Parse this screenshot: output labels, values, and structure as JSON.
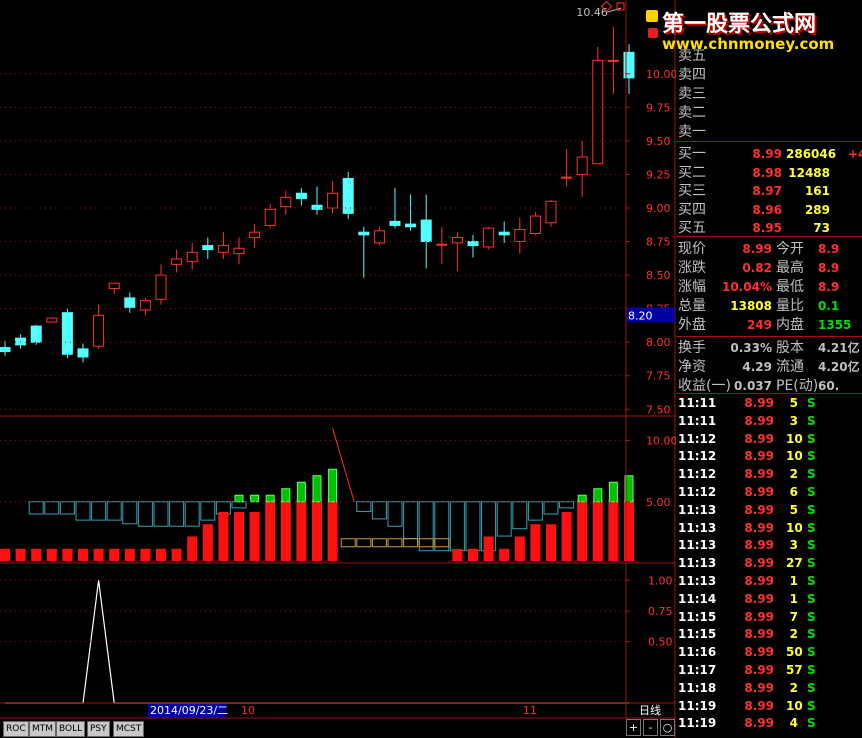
{
  "chart_data": [
    {
      "type": "candlestick",
      "y_ticks": [
        "10.00",
        "9.75",
        "9.50",
        "9.25",
        "9.00",
        "8.75",
        "8.50",
        "8.25",
        "8.00",
        "7.75",
        "7.50"
      ],
      "ylim": [
        7.45,
        10.55
      ],
      "annotation_high": "10.46",
      "annotation_level": "8.20",
      "candles": [
        [
          7.96,
          7.93,
          8.01,
          7.9
        ],
        [
          8.03,
          7.98,
          8.06,
          7.95
        ],
        [
          8.12,
          8.0,
          8.13,
          7.98
        ],
        [
          8.15,
          8.18,
          8.15,
          8.18
        ],
        [
          8.22,
          7.91,
          8.25,
          7.88
        ],
        [
          7.95,
          7.89,
          7.99,
          7.85
        ],
        [
          7.97,
          8.2,
          8.28,
          7.95
        ],
        [
          8.4,
          8.44,
          8.44,
          8.36
        ],
        [
          8.33,
          8.26,
          8.37,
          8.22
        ],
        [
          8.24,
          8.31,
          8.33,
          8.2
        ],
        [
          8.32,
          8.5,
          8.58,
          8.28
        ],
        [
          8.58,
          8.62,
          8.69,
          8.52
        ],
        [
          8.6,
          8.67,
          8.74,
          8.54
        ],
        [
          8.72,
          8.69,
          8.78,
          8.62
        ],
        [
          8.67,
          8.72,
          8.82,
          8.62
        ],
        [
          8.66,
          8.7,
          8.78,
          8.58
        ],
        [
          8.78,
          8.82,
          8.88,
          8.7
        ],
        [
          8.87,
          8.99,
          9.03,
          8.85
        ],
        [
          9.01,
          9.08,
          9.13,
          8.95
        ],
        [
          9.11,
          9.07,
          9.15,
          9.02
        ],
        [
          9.02,
          8.99,
          9.16,
          8.95
        ],
        [
          9.0,
          9.11,
          9.2,
          8.96
        ],
        [
          9.22,
          8.96,
          9.27,
          8.92
        ],
        [
          8.82,
          8.8,
          8.86,
          8.48
        ],
        [
          8.74,
          8.83,
          8.86,
          8.72
        ],
        [
          8.9,
          8.87,
          9.15,
          8.85
        ],
        [
          8.88,
          8.86,
          9.1,
          8.83
        ],
        [
          8.91,
          8.75,
          9.1,
          8.55
        ],
        [
          8.73,
          8.73,
          8.86,
          8.58
        ],
        [
          8.74,
          8.78,
          8.82,
          8.53
        ],
        [
          8.75,
          8.72,
          8.8,
          8.63
        ],
        [
          8.71,
          8.85,
          8.86,
          8.69
        ],
        [
          8.82,
          8.8,
          8.9,
          8.74
        ],
        [
          8.75,
          8.84,
          8.93,
          8.66
        ],
        [
          8.81,
          8.94,
          8.97,
          8.8
        ],
        [
          8.89,
          9.05,
          9.06,
          8.86
        ],
        [
          9.23,
          9.23,
          9.44,
          9.16
        ],
        [
          9.25,
          9.38,
          9.5,
          9.08
        ],
        [
          9.33,
          10.1,
          10.2,
          9.33
        ],
        [
          10.1,
          10.1,
          10.35,
          9.85
        ],
        [
          10.16,
          9.97,
          10.22,
          9.85
        ]
      ]
    },
    {
      "type": "bar",
      "y_ticks": [
        "10.00",
        "5.00"
      ],
      "ylim": [
        0,
        12
      ],
      "base": 5,
      "red": [
        1,
        1,
        1,
        1,
        1,
        1,
        1,
        1,
        1,
        1,
        1,
        1,
        2,
        3,
        4,
        4,
        4,
        5,
        5,
        5,
        5,
        5,
        0,
        0,
        0,
        0,
        0,
        0,
        0,
        -1,
        1,
        2,
        1,
        2,
        3,
        3,
        4,
        5,
        5,
        5,
        5
      ],
      "green": [
        0,
        0,
        0,
        0,
        0,
        0,
        0,
        0,
        0,
        0,
        0,
        0,
        0,
        0,
        0,
        1,
        1,
        1,
        2,
        3,
        4,
        5,
        0,
        0,
        0,
        0,
        0,
        0,
        0,
        0,
        0,
        0,
        0,
        0,
        0,
        0,
        0,
        1,
        2,
        3,
        4
      ],
      "cyan_line": [
        5,
        5,
        4,
        4,
        4,
        3.5,
        3.5,
        3.5,
        3.2,
        3,
        3,
        3,
        3,
        3.5,
        4,
        4.5,
        5,
        5,
        5,
        5,
        5,
        5,
        5,
        4.2,
        3.6,
        3,
        2,
        1,
        1,
        1,
        1,
        1,
        2.2,
        2.8,
        3.5,
        4,
        4.5,
        5,
        5,
        5,
        5
      ]
    },
    {
      "type": "line",
      "y_ticks": [
        "1.00",
        "0.75",
        "0.50"
      ],
      "ylim": [
        0,
        1.1
      ],
      "values": [
        0,
        0,
        0,
        0,
        0,
        0,
        1,
        0,
        0,
        0,
        0,
        0,
        0,
        0,
        0,
        0,
        0,
        0,
        0,
        0,
        0,
        0,
        0,
        0,
        0,
        0,
        0,
        0,
        0,
        0,
        0,
        0,
        0,
        0,
        0,
        0,
        0,
        0,
        0,
        0,
        0
      ]
    }
  ],
  "x_axis": {
    "date_label": "2014/09/23/二",
    "month1": "10",
    "month2": "11",
    "period": "日线"
  },
  "tabs": [
    "ROC",
    "MTM",
    "BOLL",
    "PSY",
    "MCST"
  ],
  "controls": {
    "plus": "+",
    "minus": "-",
    "circle": "○"
  },
  "watermark": {
    "title": "第一股票公式网",
    "url": "www.chnmoney.com"
  },
  "orderbook": {
    "sells": [
      {
        "label": "卖五"
      },
      {
        "label": "卖四"
      },
      {
        "label": "卖三"
      },
      {
        "label": "卖二"
      },
      {
        "label": "卖一"
      }
    ],
    "buys": [
      {
        "label": "买一",
        "price": "8.99",
        "volume": "286046",
        "change": "+4"
      },
      {
        "label": "买二",
        "price": "8.98",
        "volume": "12488",
        "change": ""
      },
      {
        "label": "买三",
        "price": "8.97",
        "volume": "161",
        "change": ""
      },
      {
        "label": "买四",
        "price": "8.96",
        "volume": "289",
        "change": ""
      },
      {
        "label": "买五",
        "price": "8.95",
        "volume": "73",
        "change": ""
      }
    ]
  },
  "quote": [
    {
      "l1": "现价",
      "v1": "8.99",
      "l2": "今开",
      "v2": "8.9",
      "c1": "#ff3030",
      "c2": "#ff3030"
    },
    {
      "l1": "涨跌",
      "v1": "0.82",
      "l2": "最高",
      "v2": "8.9",
      "c1": "#ff3030",
      "c2": "#ff3030"
    },
    {
      "l1": "涨幅",
      "v1": "10.04%",
      "l2": "最低",
      "v2": "8.9",
      "c1": "#ff3030",
      "c2": "#ff3030"
    },
    {
      "l1": "总量",
      "v1": "13808",
      "l2": "量比",
      "v2": "0.1",
      "c1": "#ffff40",
      "c2": "#00e000"
    },
    {
      "l1": "外盘",
      "v1": "249",
      "l2": "内盘",
      "v2": "1355",
      "c1": "#ff3030",
      "c2": "#00e000"
    },
    {
      "l1": "换手",
      "v1": "0.33%",
      "l2": "股本",
      "v2": "4.21亿",
      "c1": "#c0c0c0",
      "c2": "#c0c0c0"
    },
    {
      "l1": "净资",
      "v1": "4.29",
      "l2": "流通",
      "v2": "4.20亿",
      "c1": "#c0c0c0",
      "c2": "#c0c0c0"
    },
    {
      "l1": "收益(一)",
      "v1": "0.037",
      "l2": "PE(动)",
      "v2": "60.",
      "c1": "#c0c0c0",
      "c2": "#c0c0c0"
    }
  ],
  "ticks": [
    {
      "time": "11:11",
      "price": "8.99",
      "vol": "5",
      "side": "S"
    },
    {
      "time": "11:11",
      "price": "8.99",
      "vol": "3",
      "side": "S"
    },
    {
      "time": "11:12",
      "price": "8.99",
      "vol": "10",
      "side": "S"
    },
    {
      "time": "11:12",
      "price": "8.99",
      "vol": "10",
      "side": "S"
    },
    {
      "time": "11:12",
      "price": "8.99",
      "vol": "2",
      "side": "S"
    },
    {
      "time": "11:12",
      "price": "8.99",
      "vol": "6",
      "side": "S"
    },
    {
      "time": "11:13",
      "price": "8.99",
      "vol": "5",
      "side": "S"
    },
    {
      "time": "11:13",
      "price": "8.99",
      "vol": "10",
      "side": "S"
    },
    {
      "time": "11:13",
      "price": "8.99",
      "vol": "3",
      "side": "S"
    },
    {
      "time": "11:13",
      "price": "8.99",
      "vol": "27",
      "side": "S"
    },
    {
      "time": "11:13",
      "price": "8.99",
      "vol": "1",
      "side": "S"
    },
    {
      "time": "11:14",
      "price": "8.99",
      "vol": "1",
      "side": "S"
    },
    {
      "time": "11:15",
      "price": "8.99",
      "vol": "7",
      "side": "S"
    },
    {
      "time": "11:15",
      "price": "8.99",
      "vol": "2",
      "side": "S"
    },
    {
      "time": "11:16",
      "price": "8.99",
      "vol": "50",
      "side": "S"
    },
    {
      "time": "11:17",
      "price": "8.99",
      "vol": "57",
      "side": "S"
    },
    {
      "time": "11:18",
      "price": "8.99",
      "vol": "2",
      "side": "S"
    },
    {
      "time": "11:19",
      "price": "8.99",
      "vol": "10",
      "side": "S"
    },
    {
      "time": "11:19",
      "price": "8.99",
      "vol": "4",
      "side": "S"
    }
  ],
  "colors": {
    "up": "#ff3030",
    "down": "#54ffff",
    "grid": "#a01010",
    "axis": "#a01010",
    "green": "#00e000"
  }
}
